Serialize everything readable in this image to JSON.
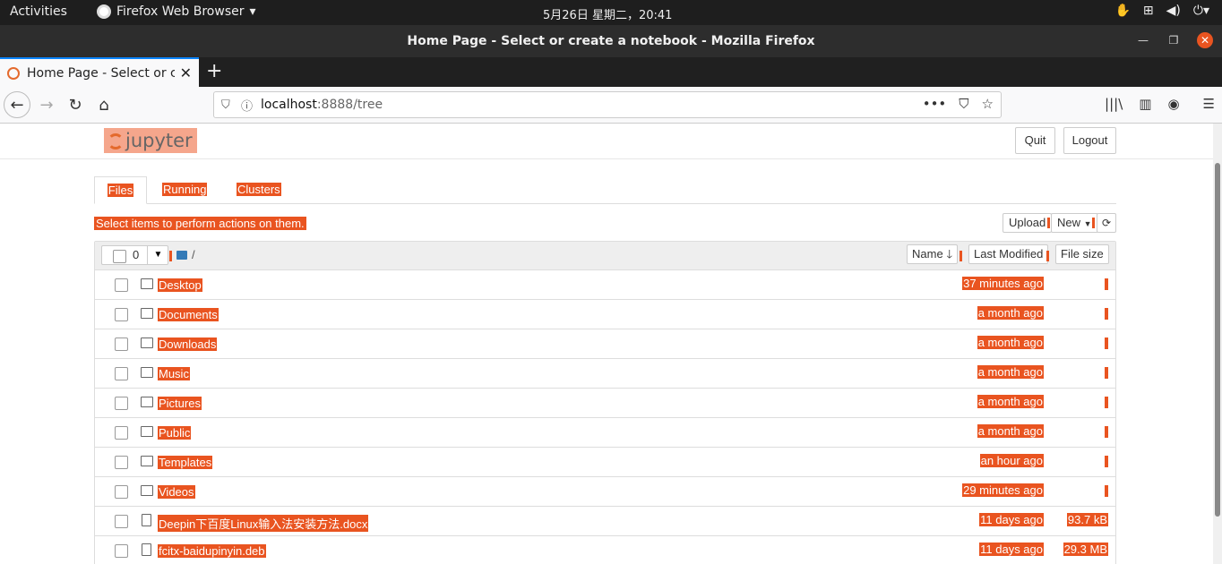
{
  "system": {
    "activities": "Activities",
    "app_name": "Firefox Web Browser",
    "clock": "5月26日 星期二，20:41"
  },
  "window": {
    "title": "Home Page - Select or create a notebook - Mozilla Firefox"
  },
  "browser": {
    "tab_title": "Home Page - Select or cr",
    "url_host": "localhost",
    "url_path": ":8888/tree"
  },
  "jupyter": {
    "logo_text": "jupyter",
    "quit_label": "Quit",
    "logout_label": "Logout",
    "tabs": [
      "Files",
      "Running",
      "Clusters"
    ],
    "hint": "Select items to perform actions on them.",
    "upload_label": "Upload",
    "new_label": "New",
    "selected_count": "0",
    "breadcrumb": "/",
    "columns": {
      "name": "Name",
      "modified": "Last Modified",
      "size": "File size"
    },
    "items": [
      {
        "name": "Desktop",
        "type": "folder",
        "modified": "37 minutes ago",
        "size": ""
      },
      {
        "name": "Documents",
        "type": "folder",
        "modified": "a month ago",
        "size": ""
      },
      {
        "name": "Downloads",
        "type": "folder",
        "modified": "a month ago",
        "size": ""
      },
      {
        "name": "Music",
        "type": "folder",
        "modified": "a month ago",
        "size": ""
      },
      {
        "name": "Pictures",
        "type": "folder",
        "modified": "a month ago",
        "size": ""
      },
      {
        "name": "Public",
        "type": "folder",
        "modified": "a month ago",
        "size": ""
      },
      {
        "name": "Templates",
        "type": "folder",
        "modified": "an hour ago",
        "size": ""
      },
      {
        "name": "Videos",
        "type": "folder",
        "modified": "29 minutes ago",
        "size": ""
      },
      {
        "name": "Deepin下百度Linux输入法安装方法.docx",
        "type": "file",
        "modified": "11 days ago",
        "size": "93.7 kB"
      },
      {
        "name": "fcitx-baidupinyin.deb",
        "type": "file",
        "modified": "11 days ago",
        "size": "29.3 MB"
      }
    ]
  }
}
